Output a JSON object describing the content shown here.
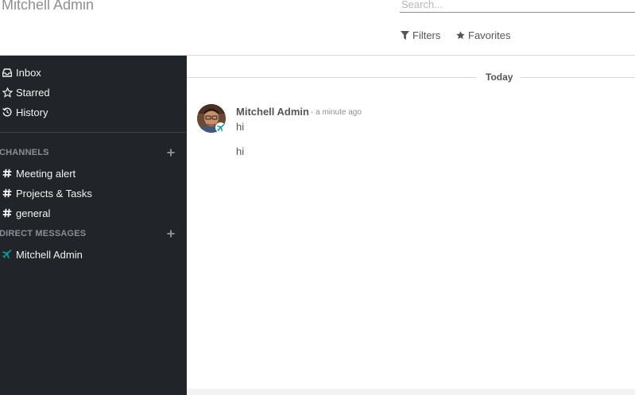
{
  "header": {
    "title": "Mitchell Admin",
    "search_placeholder": "Search...",
    "filters_label": "Filters",
    "favorites_label": "Favorites"
  },
  "sidebar": {
    "mailboxes": [
      {
        "label": "Inbox",
        "icon": "inbox-icon"
      },
      {
        "label": "Starred",
        "icon": "star-icon"
      },
      {
        "label": "History",
        "icon": "history-icon"
      }
    ],
    "channels_header": "CHANNELS",
    "channels": [
      {
        "label": "Meeting alert",
        "icon": "hashtag-icon"
      },
      {
        "label": "Projects & Tasks",
        "icon": "hashtag-icon"
      },
      {
        "label": "general",
        "icon": "hashtag-icon"
      }
    ],
    "dm_header": "DIRECT MESSAGES",
    "direct_messages": [
      {
        "label": "Mitchell Admin",
        "icon": "plane-icon"
      }
    ]
  },
  "thread": {
    "date_separator": "Today",
    "message": {
      "author": "Mitchell Admin",
      "date": "- a minute ago",
      "body_lines": [
        "hi",
        "hi"
      ]
    }
  },
  "colors": {
    "sidebar_bg": "#212529",
    "accent_teal": "#00a09d"
  }
}
